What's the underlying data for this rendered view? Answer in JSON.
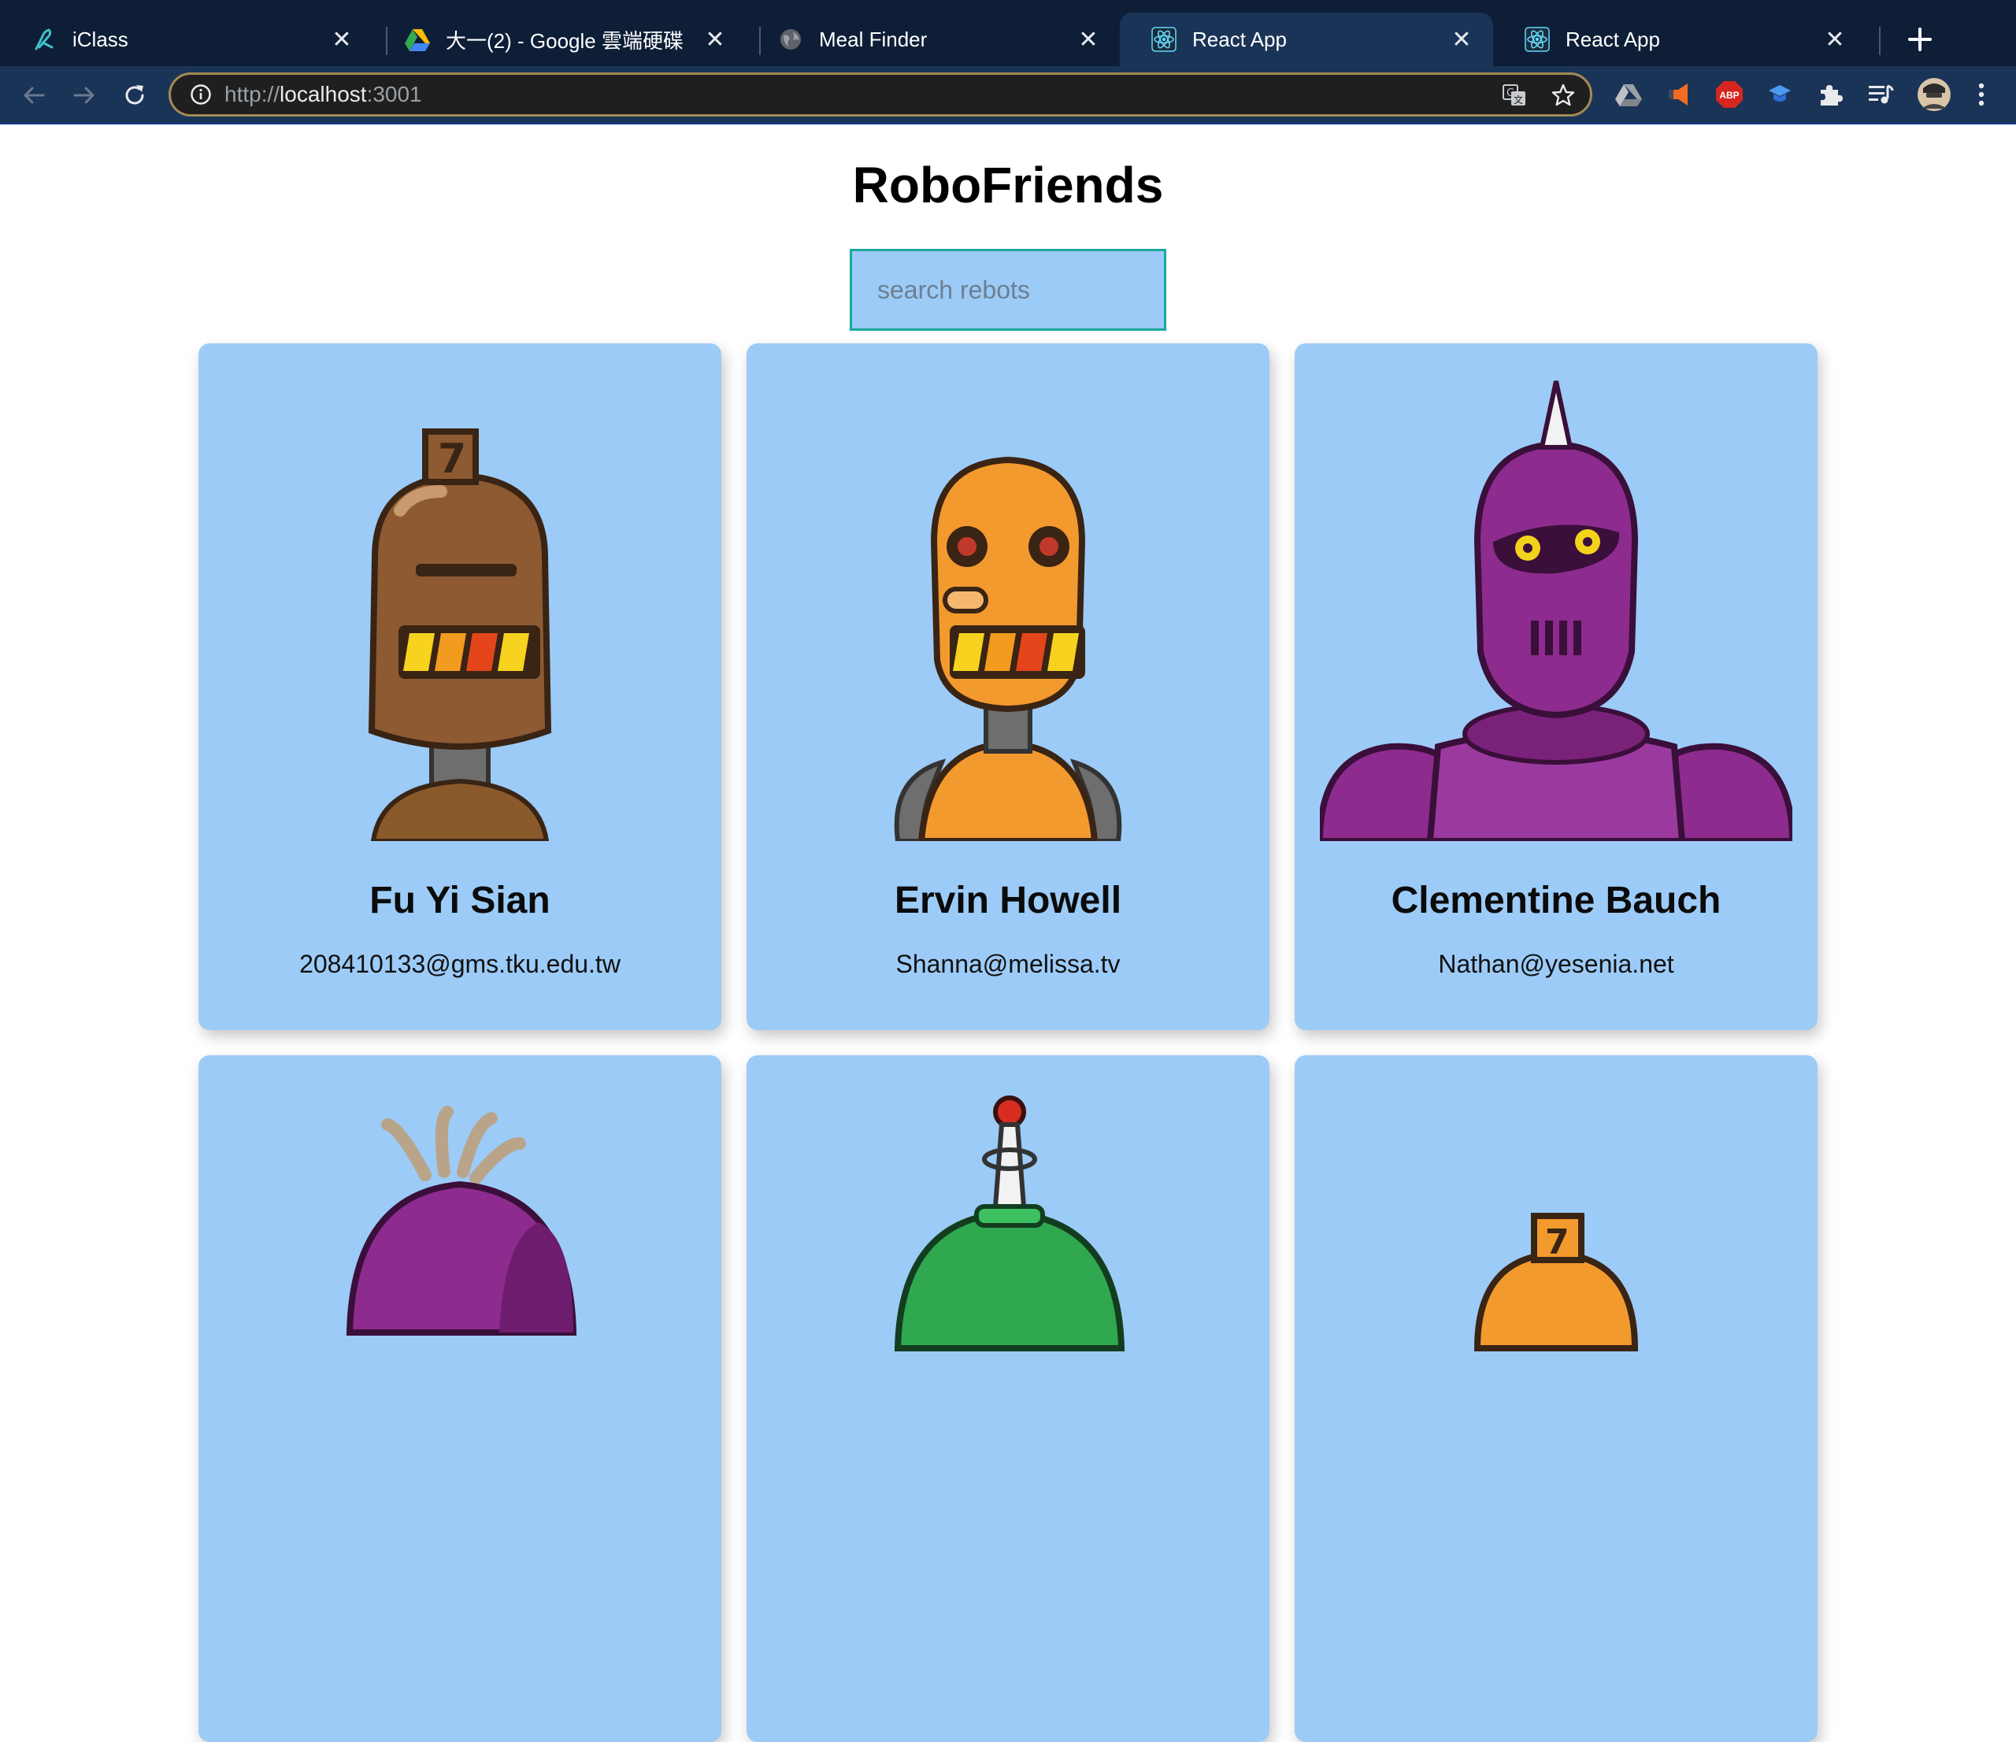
{
  "browser": {
    "tabs": [
      {
        "title": "iClass",
        "icon": "iclass-icon",
        "active": false
      },
      {
        "title": "大一(2) - Google 雲端硬碟",
        "icon": "google-drive-icon",
        "active": false
      },
      {
        "title": "Meal Finder",
        "icon": "globe-icon",
        "active": false
      },
      {
        "title": "React App",
        "icon": "react-icon",
        "active": true
      },
      {
        "title": "React App",
        "icon": "react-icon",
        "active": false
      }
    ],
    "url_scheme": "http://",
    "url_host": "localhost",
    "url_port": ":3001",
    "extensions": [
      "google-drive-icon",
      "extension-orange-icon",
      "adblock-plus-icon",
      "extension-blue-icon",
      "puzzle-icon",
      "media-control-icon",
      "profile-avatar-icon",
      "menu-dots-icon"
    ],
    "adblock_label": "ABP",
    "accent_colors": {
      "tabbar": "#0e1e37",
      "toolbar": "#1a3457"
    }
  },
  "app": {
    "title": "RoboFriends",
    "search_placeholder": "search rebots",
    "card_color": "#9ccbf7",
    "robots": [
      {
        "name": "Fu Yi Sian",
        "email": "208410133@gms.tku.edu.tw",
        "avatar": "brown-robot-icon"
      },
      {
        "name": "Ervin Howell",
        "email": "Shanna@melissa.tv",
        "avatar": "orange-robot-icon"
      },
      {
        "name": "Clementine Bauch",
        "email": "Nathan@yesenia.net",
        "avatar": "purple-robot-icon"
      },
      {
        "name": "",
        "email": "",
        "avatar": "purple-robot-icon"
      },
      {
        "name": "",
        "email": "",
        "avatar": "green-robot-icon"
      },
      {
        "name": "",
        "email": "",
        "avatar": "orange-robot-icon"
      }
    ]
  }
}
